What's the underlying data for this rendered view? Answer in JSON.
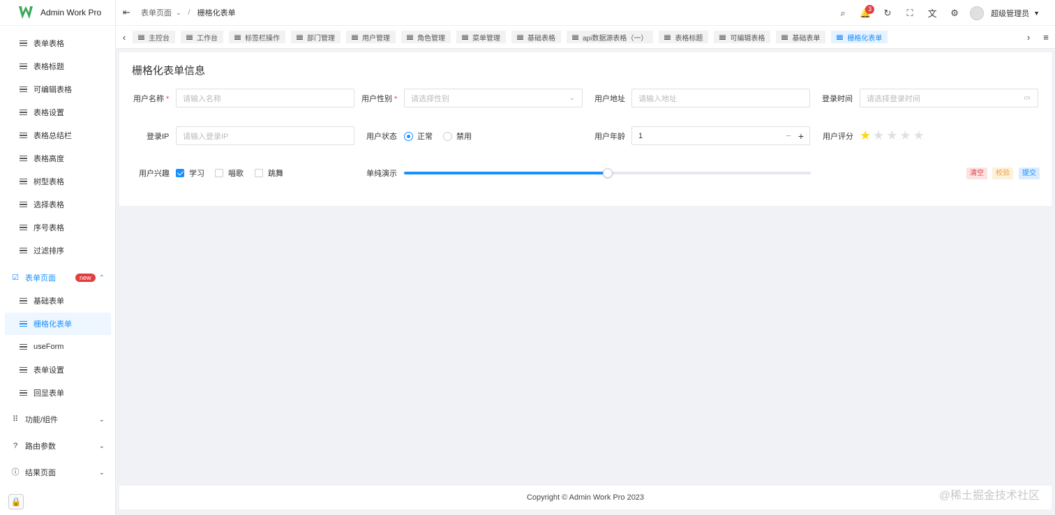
{
  "app": {
    "name": "Admin Work Pro"
  },
  "sidebar": {
    "items": [
      {
        "label": "表单表格"
      },
      {
        "label": "表格标题"
      },
      {
        "label": "可编辑表格"
      },
      {
        "label": "表格设置"
      },
      {
        "label": "表格总结栏"
      },
      {
        "label": "表格高度"
      },
      {
        "label": "树型表格"
      },
      {
        "label": "选择表格"
      },
      {
        "label": "序号表格"
      },
      {
        "label": "过滤排序"
      }
    ],
    "form_group": {
      "label": "表单页面",
      "badge": "new"
    },
    "form_items": [
      {
        "label": "基础表单"
      },
      {
        "label": "栅格化表单",
        "active": true
      },
      {
        "label": "useForm"
      },
      {
        "label": "表单设置"
      },
      {
        "label": "回显表单"
      }
    ],
    "groups": [
      {
        "label": "功能/组件",
        "icon": "grid-icon"
      },
      {
        "label": "路由参数",
        "icon": "question-icon"
      },
      {
        "label": "结果页面",
        "icon": "info-icon"
      }
    ]
  },
  "header": {
    "breadcrumb": {
      "parent": "表单页面",
      "separator": "/",
      "current": "栅格化表单"
    },
    "notification_count": "3",
    "user_name": "超级管理员"
  },
  "tabs": [
    {
      "label": "主控台"
    },
    {
      "label": "工作台"
    },
    {
      "label": "标签栏操作"
    },
    {
      "label": "部门管理"
    },
    {
      "label": "用户管理"
    },
    {
      "label": "角色管理"
    },
    {
      "label": "菜单管理"
    },
    {
      "label": "基础表格"
    },
    {
      "label": "api数据源表格（一）"
    },
    {
      "label": "表格标题"
    },
    {
      "label": "可编辑表格"
    },
    {
      "label": "基础表单"
    },
    {
      "label": "栅格化表单",
      "active": true
    }
  ],
  "form": {
    "title": "栅格化表单信息",
    "name": {
      "label": "用户名称",
      "required": "*",
      "placeholder": "请输入名称"
    },
    "gender": {
      "label": "用户性别",
      "required": "*",
      "placeholder": "请选择性别"
    },
    "address": {
      "label": "用户地址",
      "placeholder": "请输入地址"
    },
    "login_time": {
      "label": "登录时间",
      "placeholder": "请选择登录时间"
    },
    "login_ip": {
      "label": "登录IP",
      "placeholder": "请输入登录IP"
    },
    "status": {
      "label": "用户状态",
      "options": [
        "正常",
        "禁用"
      ],
      "selected": "正常"
    },
    "age": {
      "label": "用户年龄",
      "value": "1",
      "minus": "−",
      "plus": "+"
    },
    "rating": {
      "label": "用户评分",
      "value": 1,
      "max": 5
    },
    "interests": {
      "label": "用户兴趣",
      "options": [
        "学习",
        "唱歌",
        "跳舞"
      ],
      "checked": [
        "学习"
      ]
    },
    "slider": {
      "label": "单纯演示",
      "value": 50
    },
    "buttons": {
      "clear": "清空",
      "validate": "校验",
      "submit": "提交"
    }
  },
  "footer": {
    "copyright": "Copyright © Admin Work Pro 2023"
  },
  "watermark": "@稀土掘金技术社区",
  "colors": {
    "primary": "#1890ff",
    "danger": "#e13f3f",
    "star": "#fadb14"
  }
}
